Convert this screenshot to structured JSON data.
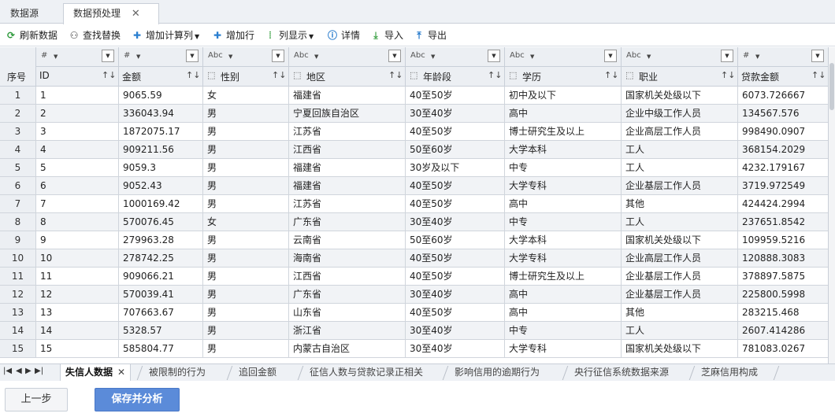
{
  "tabs": [
    {
      "label": "数据源",
      "active": false
    },
    {
      "label": "数据预处理",
      "active": true,
      "closable": true
    }
  ],
  "toolbar": [
    {
      "label": "刷新数据",
      "icon": "refresh-icon",
      "color": "#2e9a3c"
    },
    {
      "label": "查找替换",
      "icon": "binoculars-icon",
      "color": "#333333"
    },
    {
      "label": "增加计算列",
      "icon": "plus-icon",
      "color": "#2b7fd0",
      "dropdown": true
    },
    {
      "label": "增加行",
      "icon": "plus-icon",
      "color": "#2b7fd0"
    },
    {
      "label": "列显示",
      "icon": "columns-icon",
      "color": "#3aa043",
      "dropdown": true
    },
    {
      "label": "详情",
      "icon": "info-icon",
      "color": "#1a73c9"
    },
    {
      "label": "导入",
      "icon": "import-icon",
      "color": "#3aa043"
    },
    {
      "label": "导出",
      "icon": "export-icon",
      "color": "#1a73c9"
    }
  ],
  "table": {
    "rowno_header": "序号",
    "columns": [
      {
        "type": "#",
        "name": "ID"
      },
      {
        "type": "#",
        "name": "金额"
      },
      {
        "type": "Abc",
        "name": "性别"
      },
      {
        "type": "Abc",
        "name": "地区"
      },
      {
        "type": "Abc",
        "name": "年龄段"
      },
      {
        "type": "Abc",
        "name": "学历"
      },
      {
        "type": "Abc",
        "name": "职业"
      },
      {
        "type": "#",
        "name": "贷款金额"
      }
    ],
    "rows": [
      [
        "1",
        "1",
        "9065.59",
        "女",
        "福建省",
        "40至50岁",
        "初中及以下",
        "国家机关处级以下",
        "6073.726667"
      ],
      [
        "2",
        "2",
        "336043.94",
        "男",
        "宁夏回族自治区",
        "30至40岁",
        "高中",
        "企业中级工作人员",
        "134567.576"
      ],
      [
        "3",
        "3",
        "1872075.17",
        "男",
        "江苏省",
        "40至50岁",
        "博士研究生及以上",
        "企业高层工作人员",
        "998490.0907"
      ],
      [
        "4",
        "4",
        "909211.56",
        "男",
        "江西省",
        "50至60岁",
        "大学本科",
        "工人",
        "368154.2029"
      ],
      [
        "5",
        "5",
        "9059.3",
        "男",
        "福建省",
        "30岁及以下",
        "中专",
        "工人",
        "4232.179167"
      ],
      [
        "6",
        "6",
        "9052.43",
        "男",
        "福建省",
        "40至50岁",
        "大学专科",
        "企业基层工作人员",
        "3719.972549"
      ],
      [
        "7",
        "7",
        "1000169.42",
        "男",
        "江苏省",
        "40至50岁",
        "高中",
        "其他",
        "424424.2994"
      ],
      [
        "8",
        "8",
        "570076.45",
        "女",
        "广东省",
        "30至40岁",
        "中专",
        "工人",
        "237651.8542"
      ],
      [
        "9",
        "9",
        "279963.28",
        "男",
        "云南省",
        "50至60岁",
        "大学本科",
        "国家机关处级以下",
        "109959.5216"
      ],
      [
        "10",
        "10",
        "278742.25",
        "男",
        "海南省",
        "40至50岁",
        "大学专科",
        "企业高层工作人员",
        "120888.3083"
      ],
      [
        "11",
        "11",
        "909066.21",
        "男",
        "江西省",
        "40至50岁",
        "博士研究生及以上",
        "企业基层工作人员",
        "378897.5875"
      ],
      [
        "12",
        "12",
        "570039.41",
        "男",
        "广东省",
        "30至40岁",
        "高中",
        "企业基层工作人员",
        "225800.5998"
      ],
      [
        "13",
        "13",
        "707663.67",
        "男",
        "山东省",
        "40至50岁",
        "高中",
        "其他",
        "283215.468"
      ],
      [
        "14",
        "14",
        "5328.57",
        "男",
        "浙江省",
        "30至40岁",
        "中专",
        "工人",
        "2607.414286"
      ],
      [
        "15",
        "15",
        "585804.77",
        "男",
        "内蒙古自治区",
        "30至40岁",
        "大学专科",
        "国家机关处级以下",
        "781083.0267"
      ]
    ]
  },
  "sheet_tabs": [
    {
      "label": "失信人数据",
      "active": true,
      "closable": true
    },
    {
      "label": "被限制的行为"
    },
    {
      "label": "追回金额"
    },
    {
      "label": "征信人数与贷款记录正相关"
    },
    {
      "label": "影响信用的逾期行为"
    },
    {
      "label": "央行征信系统数据来源"
    },
    {
      "label": "芝麻信用构成"
    }
  ],
  "footer": {
    "prev_label": "上一步",
    "save_label": "保存并分析"
  },
  "colors": {
    "accent": "#5b8bd9",
    "header_bg": "#eceff3",
    "alt_row": "#f1f3f6"
  }
}
